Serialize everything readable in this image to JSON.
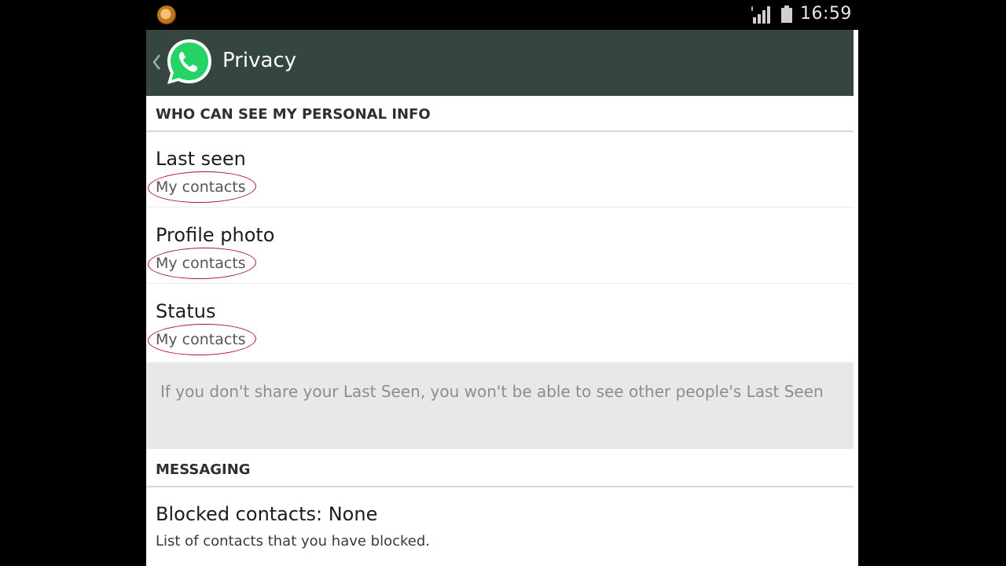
{
  "status_bar": {
    "time": "16:59"
  },
  "action_bar": {
    "title": "Privacy"
  },
  "personal_info": {
    "header": "WHO CAN SEE MY PERSONAL INFO",
    "items": [
      {
        "title": "Last seen",
        "value": "My contacts"
      },
      {
        "title": "Profile photo",
        "value": "My contacts"
      },
      {
        "title": "Status",
        "value": "My contacts"
      }
    ],
    "info_note": "If you don't share your Last Seen, you won't be able to see other people's Last Seen"
  },
  "messaging": {
    "header": "MESSAGING",
    "blocked": {
      "title": "Blocked contacts: None",
      "subtitle": "List of contacts that you have blocked."
    }
  },
  "colors": {
    "action_bar": "#34463f",
    "whatsapp_green": "#25d366",
    "annotation": "#a8192a"
  }
}
